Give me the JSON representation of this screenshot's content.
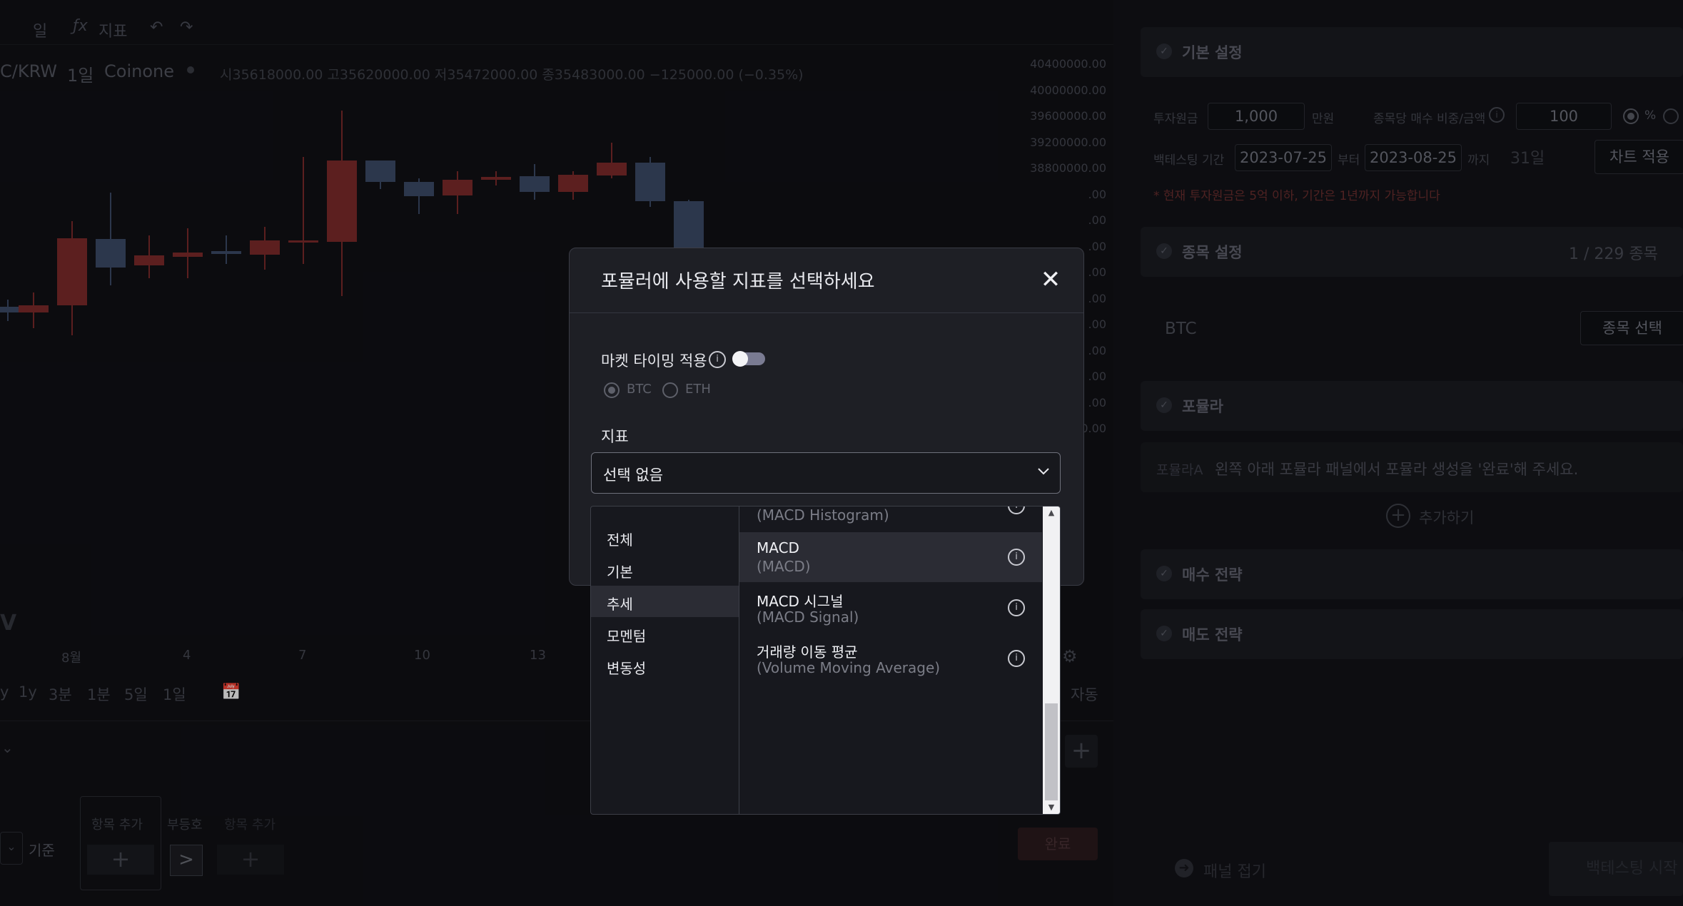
{
  "toolbar": {
    "interval": "일",
    "fx_icon": "fx-icon",
    "indicator_label": "지표",
    "undo": "↶",
    "redo": "↷"
  },
  "chart": {
    "symbol": "C/KRW",
    "interval": "1일",
    "exchange": "Coinone",
    "ohlc": "시35618000.00 고35620000.00 저35472000.00 종35483000.00 −125000.00 (−0.35%)",
    "price_labels": [
      "40400000.00",
      "40000000.00",
      "39600000.00",
      "39200000.00",
      "38800000.00",
      ".00",
      ".00",
      ".00",
      ".00",
      ".00",
      ".00",
      ".00",
      ".00",
      ".00",
      "0000.00"
    ],
    "date_labels": [
      "8월",
      "4",
      "7",
      "10",
      "13"
    ],
    "range_buttons": [
      "y",
      "1y",
      "3분",
      "1분",
      "5일",
      "1일"
    ],
    "auto_label": "자동",
    "watermark": "V"
  },
  "bottom_panel": {
    "add_item": "항목 추가",
    "sign": "부등호",
    "add_item2": "항목 추가",
    "base_label": "기준",
    "done_button": "완료"
  },
  "right_panel": {
    "basic_settings": "기본 설정",
    "invest_label": "투자원금",
    "invest_value": "1,000",
    "invest_unit": "만원",
    "per_stock_label": "종목당 매수 비중/금액",
    "per_stock_value": "100",
    "percent_label": "%",
    "period_label": "백테스팅 기간",
    "start_date": "2023-07-25",
    "from_label": "부터",
    "end_date": "2023-08-25",
    "to_label": "까지",
    "days": "31일",
    "apply_chart": "차트 적용",
    "notice": "* 현재 투자원금은 5억 이하, 기간은 1년까지 가능합니다",
    "stock_settings": "종목 설정",
    "stock_count": "1 / 229  종목",
    "stock_name": "BTC",
    "select_stock": "종목 선택",
    "formula": "포뮬라",
    "formula_a_label": "포뮬라A",
    "formula_a_text": "왼쪽 아래 포뮬라 패널에서 포뮬라 생성을 '완료'해 주세요.",
    "add_button": "추가하기",
    "buy_strategy": "매수 전략",
    "sell_strategy": "매도 전략",
    "collapse_panel": "패널 접기",
    "run_backtest": "백테스팅 시작"
  },
  "modal": {
    "title": "포뮬러에 사용할 지표를 선택하세요",
    "market_timing_label": "마켓 타이밍 적용",
    "market_timing_on": false,
    "radio_options": [
      "BTC",
      "ETH"
    ],
    "radio_selected": "BTC",
    "indicator_label": "지표",
    "select_value": "선택 없음",
    "categories": [
      "전체",
      "기본",
      "추세",
      "모멘텀",
      "변동성"
    ],
    "active_category": "추세",
    "items": [
      {
        "name": "",
        "sub": "(MACD Histogram)"
      },
      {
        "name": "MACD",
        "sub": "(MACD)"
      },
      {
        "name": "MACD 시그널",
        "sub": "(MACD Signal)"
      },
      {
        "name": "거래량 이동 평균",
        "sub": "(Volume Moving Average)"
      }
    ],
    "highlighted_item": "MACD"
  },
  "colors": {
    "bear": "#7b2a2a",
    "bull": "#3b4a66",
    "accent_toggle": "#7a7b92"
  }
}
